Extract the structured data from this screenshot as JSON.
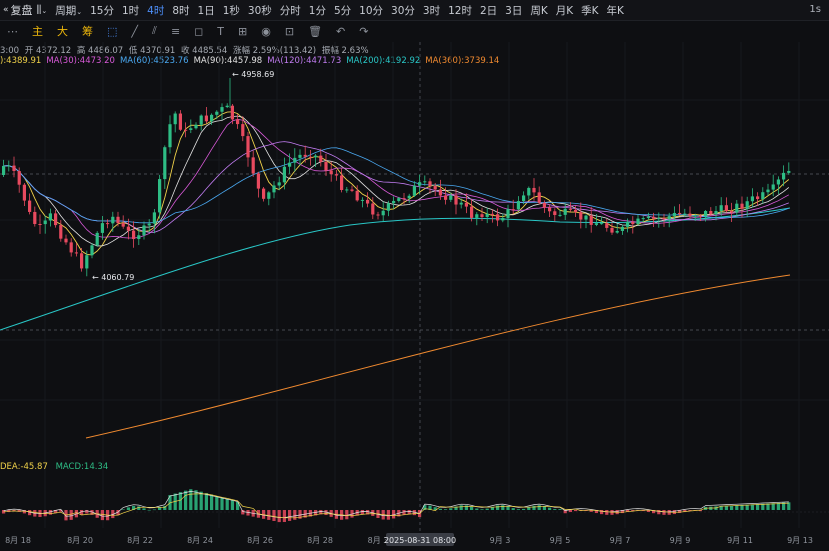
{
  "toolbar": {
    "replay_label": "复盘",
    "period_label": "周期",
    "intervals": [
      "15分",
      "1时",
      "4时",
      "8时",
      "1日",
      "1秒",
      "30秒",
      "分时",
      "1分",
      "5分",
      "10分",
      "30分",
      "3时",
      "12时",
      "2日",
      "3日",
      "周K",
      "月K",
      "季K",
      "年K"
    ],
    "active_interval": "4时",
    "right_label": "1s"
  },
  "toolbar2": {
    "indicators": [
      "主",
      "大",
      "筹"
    ]
  },
  "ohlc": {
    "time_prefix": "3:00",
    "open": "开 4372.12",
    "high": "高 4486.07",
    "low": "低 4370.91",
    "close": "收 4485.54",
    "change": "涨幅 2.59%(113.42)",
    "amplitude": "振幅 2.63%"
  },
  "ma": [
    {
      "label": "):4389.91",
      "color": "#f0d24a"
    },
    {
      "label": "MA(30):4473.20",
      "color": "#d95ad9"
    },
    {
      "label": "MA(60):4523.76",
      "color": "#4aa8f0"
    },
    {
      "label": "MA(90):4457.98",
      "color": "#e3e3e3"
    },
    {
      "label": "MA(120):4471.73",
      "color": "#c07cf0"
    },
    {
      "label": "MA(200):4192.92",
      "color": "#29c7c7"
    },
    {
      "label": "MA(360):3739.14",
      "color": "#f08a30"
    }
  ],
  "macd": {
    "dea": "DEA:-45.87",
    "macd": "MACD:14.34"
  },
  "annotations": {
    "high": "← 4958.69",
    "low": "← 4060.79"
  },
  "crosshair_label": "2025-08-31 08:00",
  "x_labels": [
    "8月 18",
    "8月 20",
    "8月 22",
    "8月 24",
    "8月 26",
    "8月 28",
    "8月 3",
    "9月 3",
    "9月 5",
    "9月 7",
    "9月 9",
    "9月 11",
    "9月 13"
  ],
  "colors": {
    "up": "#2ebd85",
    "down": "#e84a5f",
    "accent": "#4d8ef7"
  }
}
